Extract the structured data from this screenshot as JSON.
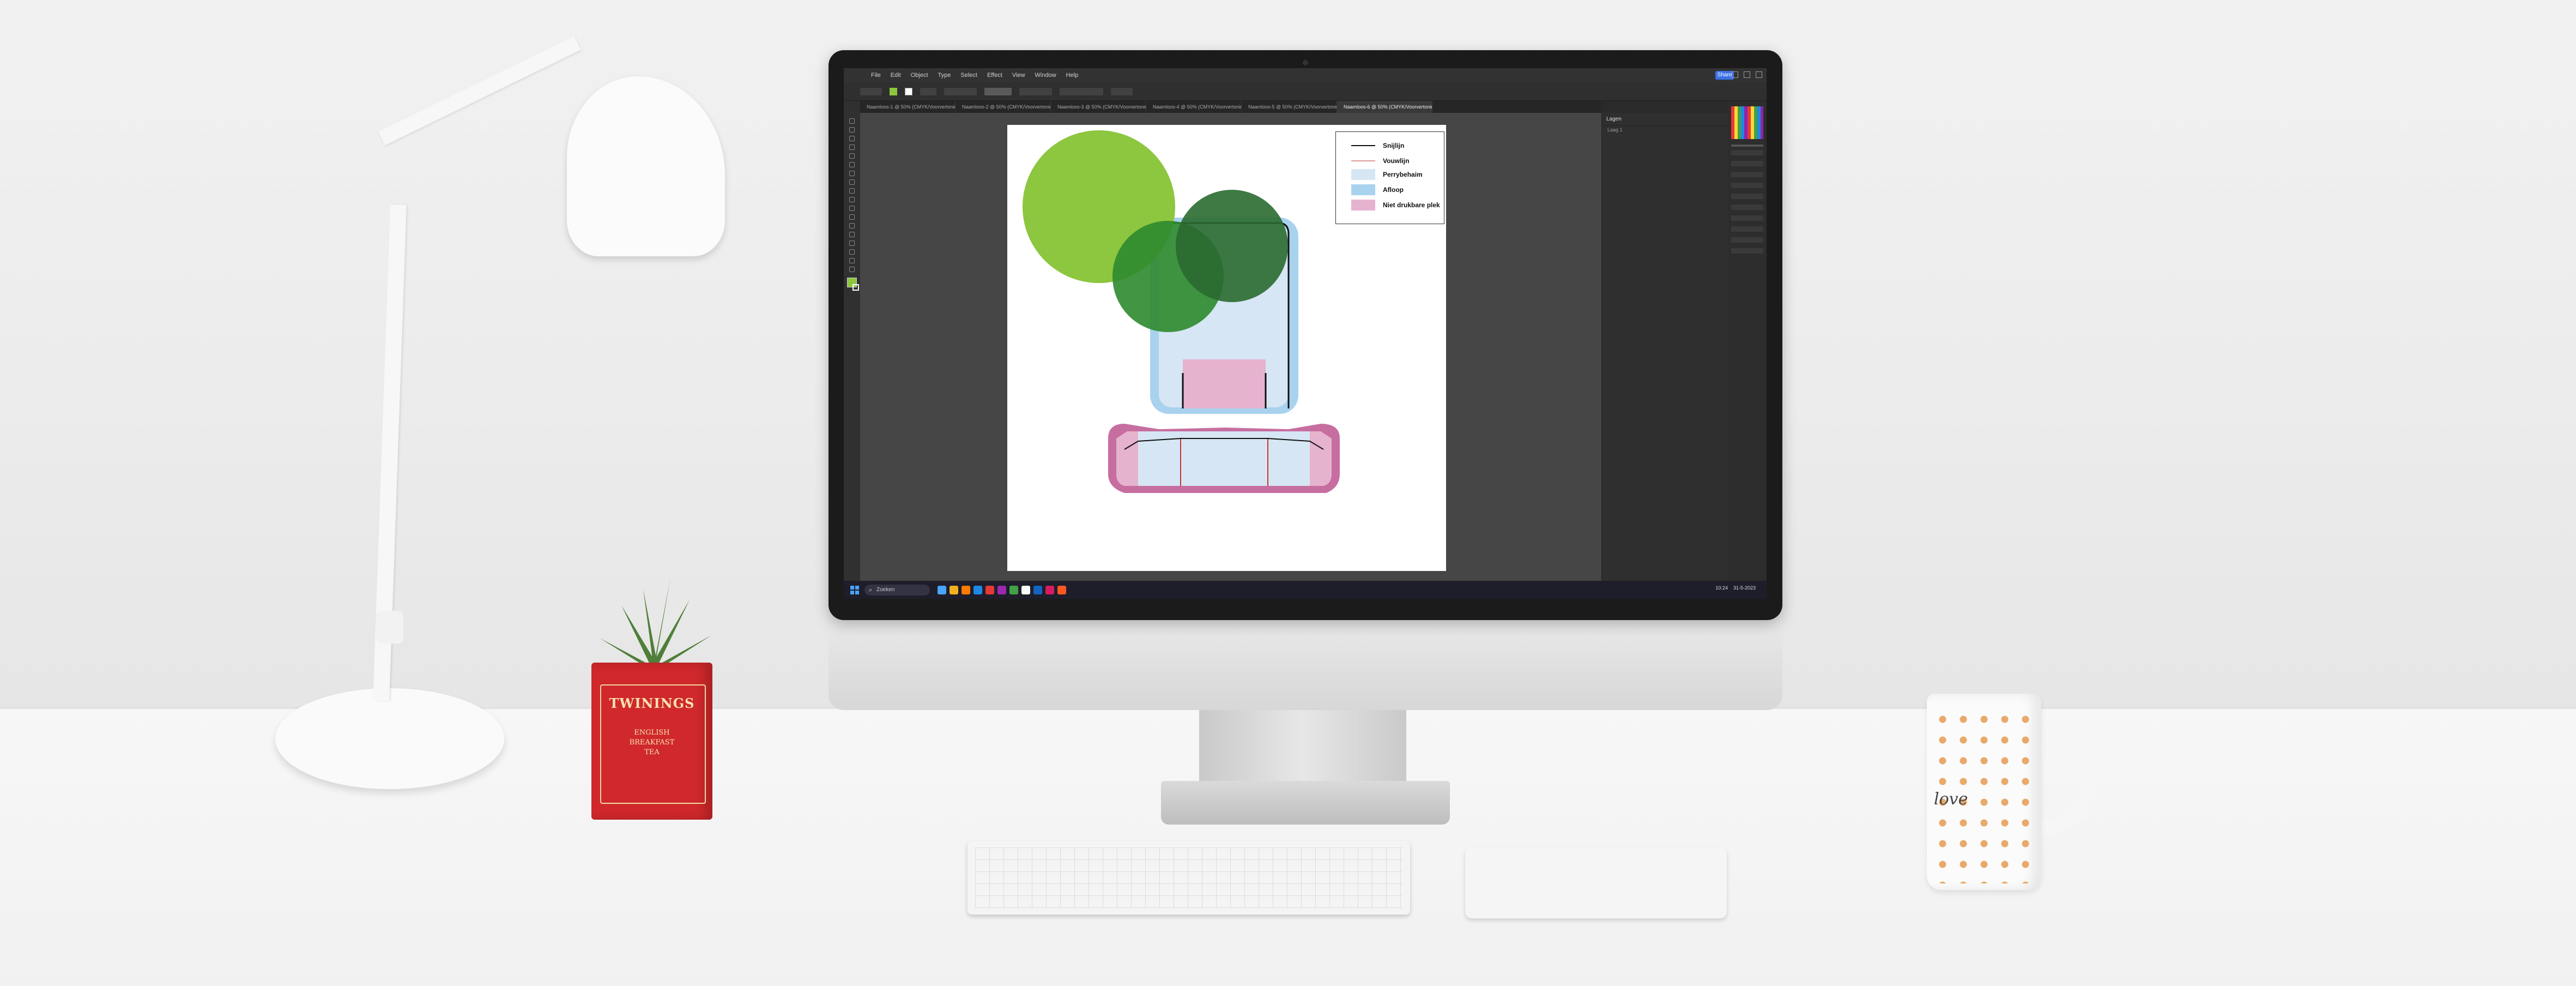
{
  "app": {
    "menu": [
      "File",
      "Edit",
      "Object",
      "Type",
      "Select",
      "Effect",
      "View",
      "Window",
      "Help"
    ],
    "share_label": "Share",
    "tabs": [
      "Naamloos-1 @ 50% (CMYK/Voorvertoning)",
      "Naamloos-2 @ 50% (CMYK/Voorvertoning)",
      "Naamloos-3 @ 50% (CMYK/Voorvertoning)",
      "Naamloos-4 @ 50% (CMYK/Voorvertoning)",
      "Naamloos-5 @ 50% (CMYK/Voorvertoning)",
      "Naamloos-6 @ 50% (CMYK/Voorvertoning)"
    ],
    "active_tab": 5,
    "layers_panel_title": "Lagen",
    "layer_name": "Laag 1",
    "taskbar_search": "Zoeken",
    "tray_time": "10:24",
    "tray_date": "31-5-2023"
  },
  "legend": {
    "items": [
      {
        "label": "Snijlijn",
        "kind": "line",
        "color": "#111111"
      },
      {
        "label": "Vouwlijn",
        "kind": "line",
        "color": "#d99a9a"
      },
      {
        "label": "Perrybehaim",
        "kind": "box",
        "color": "#d6e6f4"
      },
      {
        "label": "Afloop",
        "kind": "box",
        "color": "#a9d2ee"
      },
      {
        "label": "Niet drukbare plek",
        "kind": "box",
        "color": "#e6b3cf"
      }
    ]
  },
  "colors": {
    "accent_green": "#8dc63f",
    "dark_green": "#2d7d2d",
    "deep_green": "#2a6a30",
    "light_blue": "#bfdcf0",
    "blue_outline": "#6fb3e3",
    "pink": "#e6b3cf",
    "magenta": "#c76ea0"
  },
  "props": {
    "pot_brand": "TWININGS",
    "pot_sub1": "ENGLISH",
    "pot_sub2": "BREAKFAST",
    "pot_sub3": "TEA",
    "mug_text": "love"
  }
}
